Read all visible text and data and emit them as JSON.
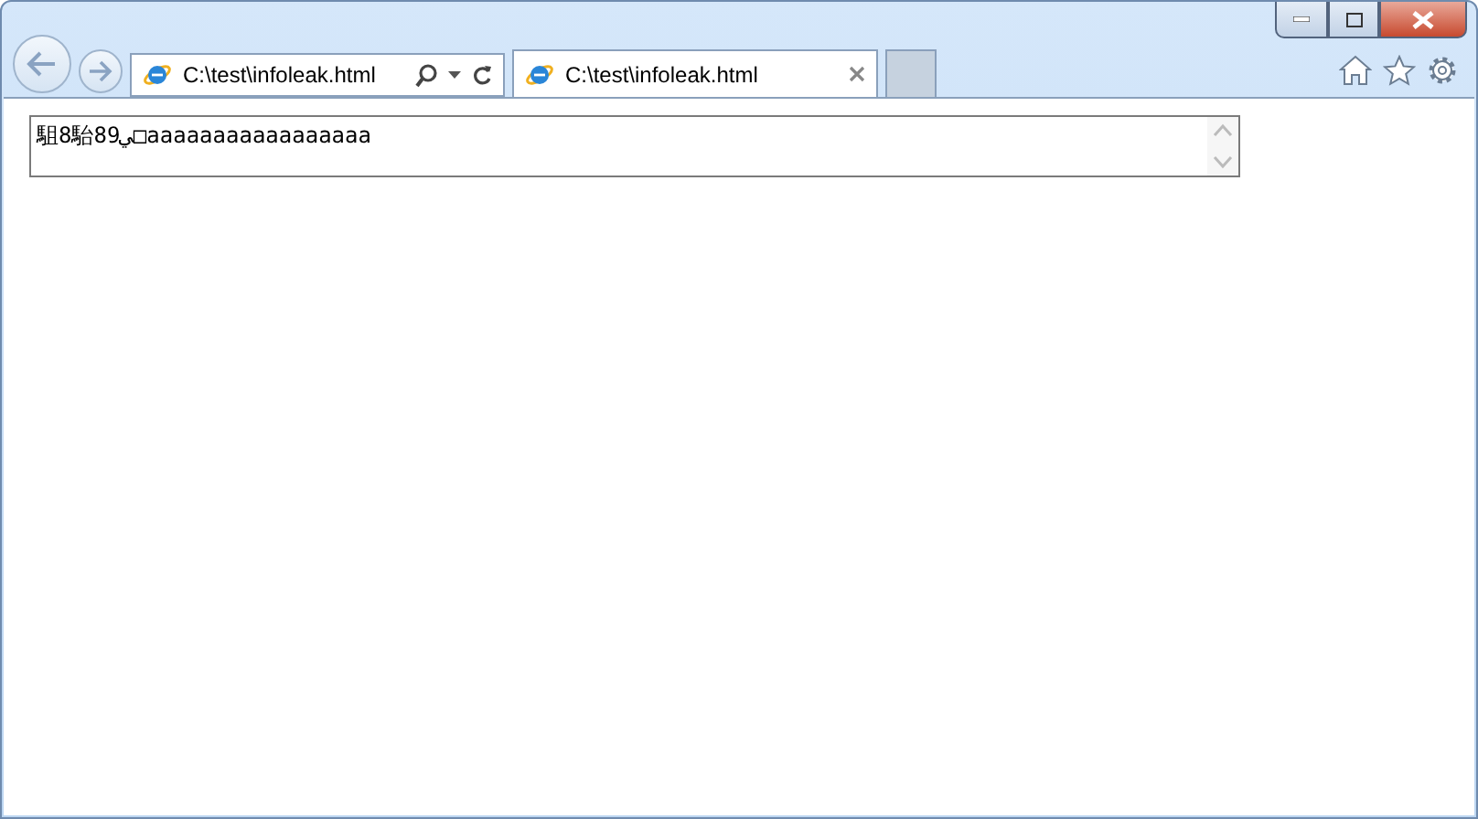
{
  "address_bar": {
    "value": "C:\\test\\infoleak.html"
  },
  "tabs": [
    {
      "label": "C:\\test\\infoleak.html",
      "selected": true
    }
  ],
  "textarea": {
    "value": "駔8駘89ﻲ□aaaaaaaaaaaaaaaaa"
  }
}
